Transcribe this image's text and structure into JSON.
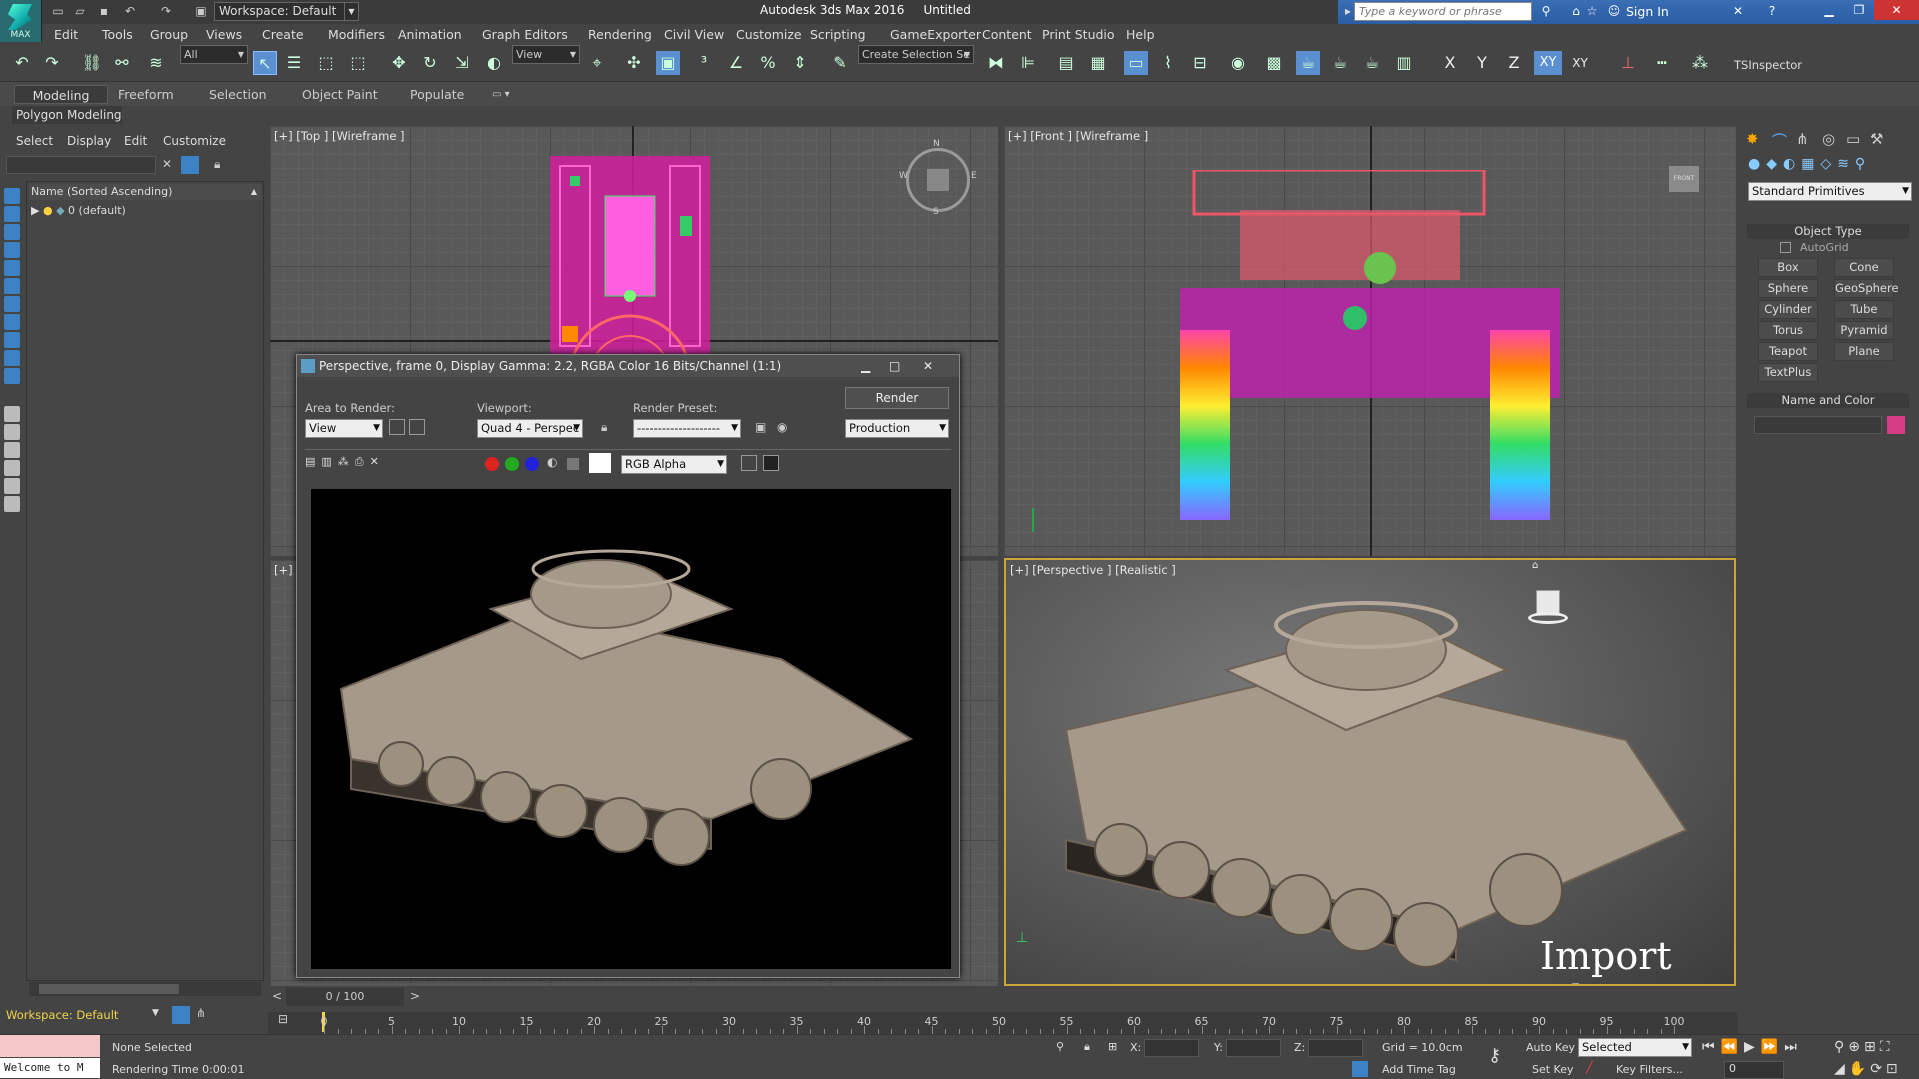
{
  "titlebar": {
    "workspace": "Workspace: Default",
    "app_title": "Autodesk 3ds Max 2016",
    "doc_title": "Untitled",
    "search_placeholder": "Type a keyword or phrase",
    "sign_in": "Sign In",
    "logo_text": "MAX"
  },
  "menu": [
    "Edit",
    "Tools",
    "Group",
    "Views",
    "Create",
    "Modifiers",
    "Animation",
    "Graph Editors",
    "Rendering",
    "Civil View",
    "Customize",
    "Scripting",
    "GameExporter",
    "Content",
    "Print Studio",
    "Help"
  ],
  "toolbar": {
    "filter_value": "All",
    "refcoord_value": "View",
    "selection_set_placeholder": "Create Selection Se",
    "axis_labels": [
      "X",
      "Y",
      "Z",
      "XY",
      "XY"
    ],
    "tsinspector": "TSInspector"
  },
  "ribbon": {
    "tabs": [
      "Modeling",
      "Freeform",
      "Selection",
      "Object Paint",
      "Populate"
    ],
    "active_tab": "Modeling",
    "panel_label": "Polygon Modeling"
  },
  "scene_explorer": {
    "menu": [
      "Select",
      "Display",
      "Edit",
      "Customize"
    ],
    "column_header": "Name (Sorted Ascending)",
    "items": [
      {
        "label": "0 (default)"
      }
    ],
    "workspace_label": "Workspace: Default"
  },
  "viewports": {
    "top": "[+] [Top ] [Wireframe ]",
    "front": "[+] [Front ] [Wireframe ]",
    "left_partial": "[+]",
    "perspective": "[+] [Perspective ] [Realistic ]",
    "watermark": "Import Obj",
    "compass_letters": [
      "N",
      "E",
      "S",
      "W"
    ],
    "viewcube_front": "FRONT"
  },
  "render_window": {
    "title": "Perspective, frame 0, Display Gamma: 2.2, RGBA Color 16 Bits/Channel (1:1)",
    "area_to_render_label": "Area to Render:",
    "area_to_render_value": "View",
    "viewport_label": "Viewport:",
    "viewport_value": "Quad 4 - Perspec",
    "render_preset_label": "Render Preset:",
    "render_preset_value": "--------------------",
    "render_button": "Render",
    "production_value": "Production",
    "channel_value": "RGB Alpha"
  },
  "command_panel": {
    "category": "Standard Primitives",
    "object_type_title": "Object Type",
    "autogrid": "AutoGrid",
    "buttons": [
      "Box",
      "Cone",
      "Sphere",
      "GeoSphere",
      "Cylinder",
      "Tube",
      "Torus",
      "Pyramid",
      "Teapot",
      "Plane",
      "TextPlus"
    ],
    "name_color_title": "Name and Color",
    "swatch_color": "#d63b86"
  },
  "timeline": {
    "frame_counter": "0 / 100",
    "ticks": [
      "0",
      "5",
      "10",
      "15",
      "20",
      "25",
      "30",
      "35",
      "40",
      "45",
      "50",
      "55",
      "60",
      "65",
      "70",
      "75",
      "80",
      "85",
      "90",
      "95",
      "100"
    ]
  },
  "status": {
    "listener": "Welcome to M",
    "selection": "None Selected",
    "render_time": "Rendering Time  0:00:01",
    "x_label": "X:",
    "y_label": "Y:",
    "z_label": "Z:",
    "grid": "Grid = 10.0cm",
    "add_time_tag": "Add Time Tag",
    "auto_key": "Auto Key",
    "set_key": "Set Key",
    "key_mode_value": "Selected",
    "key_filters": "Key Filters...",
    "frame_value": "0"
  },
  "colors": {
    "accent_blue": "#3b83c4",
    "active_border": "#c9a43a",
    "workspace_text": "#f0d44a"
  }
}
